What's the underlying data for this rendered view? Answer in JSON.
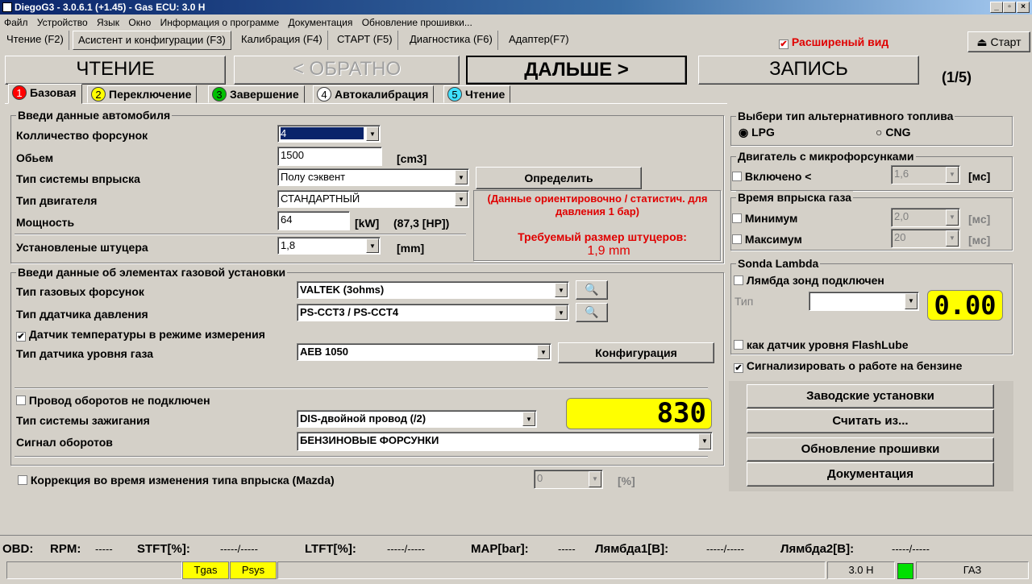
{
  "window": {
    "title": "DiegoG3 - 3.0.6.1 (+1.45) - Gas ECU: 3.0 H",
    "min": "_",
    "max": "▫",
    "close": "×"
  },
  "menu": [
    "Файл",
    "Устройство",
    "Язык",
    "Окно",
    "Информация о программе",
    "Документация",
    "Обновление прошивки..."
  ],
  "toptabs": [
    "Чтение (F2)",
    "Асистент и конфигурации (F3)",
    "Калибрация (F4)",
    "СТАРТ (F5)",
    "Диагностика (F6)",
    "Адаптер(F7)"
  ],
  "extended_view": {
    "label": "Расширеный вид",
    "checked": "✔"
  },
  "start_button": "Старт",
  "nav": {
    "read": "ЧТЕНИЕ",
    "back": "< ОБРАТНО",
    "next": "ДАЛЬШЕ >",
    "write": "ЗАПИСЬ",
    "step": "(1/5)"
  },
  "subtabs": [
    {
      "num": "1",
      "label": "Базовая",
      "color": "#ff0000"
    },
    {
      "num": "2",
      "label": "Переключение",
      "color": "#ffff00"
    },
    {
      "num": "3",
      "label": "Завершение",
      "color": "#00c000"
    },
    {
      "num": "4",
      "label": "Автокалибрация",
      "color": "#ffffff"
    },
    {
      "num": "5",
      "label": "Чтение",
      "color": "#40e0ff"
    }
  ],
  "car": {
    "title": "Введи данные автомобиля",
    "injectors_label": "Колличество форсунок",
    "injectors_value": "4",
    "volume_label": "Обьем",
    "volume_value": "1500",
    "volume_unit": "[cm3]",
    "injection_label": "Тип системы впрыска",
    "injection_value": "Полу сэквент",
    "engine_label": "Тип двигателя",
    "engine_value": "СТАНДАРТНЫЙ",
    "power_label": "Мощность",
    "power_value": "64",
    "power_unit": "[kW]",
    "power_hp": "(87,3 [HP])",
    "nozzle_label": "Установленые штуцера",
    "nozzle_value": "1,8",
    "nozzle_unit": "[mm]",
    "determine_button": "Определить",
    "note": "(Данные ориентировочно / статистич. для давления 1 бар)",
    "required_label": "Требуемый размер штуцеров:",
    "required_value": "1,9 mm"
  },
  "gas": {
    "title": "Введи данные об элементах газовой установки",
    "injector_type_label": "Тип газовых форсунок",
    "injector_type_value": "VALTEK (3ohms)",
    "pressure_label": "Тип ддатчика давления",
    "pressure_value": "PS-CCT3 / PS-CCT4",
    "temp_label": "Датчик температуры в режиме измерения",
    "temp_checked": "✔",
    "level_label": "Тип датчика уровня газа",
    "level_value": "AEB 1050",
    "config_button": "Конфигурация",
    "rpm_wire_label": "Провод оборотов не подключен",
    "ignition_label": "Тип системы зажигания",
    "ignition_value": "DIS-двойной провод (/2)",
    "rpm_signal_label": "Сигнал оборотов",
    "rpm_signal_value": "БЕНЗИНОВЫЕ ФОРСУНКИ",
    "rpm_display": "830"
  },
  "correction": {
    "label": "Коррекция во время изменения типа впрыска (Mazda)",
    "value": "0",
    "unit": "[%]"
  },
  "fuel": {
    "title": "Выбери тип альтернативного топлива",
    "lpg": "LPG",
    "cng": "CNG"
  },
  "micro": {
    "title": "Двигатель с микрофорсунками",
    "enabled_label": "Включено <",
    "value": "1,6",
    "unit": "[мс]"
  },
  "gas_time": {
    "title": "Время впрыска газа",
    "min_label": "Минимум",
    "min_value": "2,0",
    "min_unit": "[мс]",
    "max_label": "Максимум",
    "max_value": "20",
    "max_unit": "[мс]"
  },
  "lambda": {
    "title": "Sonda Lambda",
    "connected_label": "Лямбда зонд подключен",
    "type_label": "Тип",
    "display": "0.00",
    "flashlube_label": "как датчик уровня FlashLube"
  },
  "petrol_signal": {
    "label": "Сигнализировать о работе на бензине",
    "checked": "✔"
  },
  "side_buttons": [
    "Заводские установки",
    "Считать из...",
    "Обновление прошивки",
    "Документация"
  ],
  "obd": {
    "obd": "OBD:",
    "rpm": "RPM:",
    "rpm_val": "-----",
    "stft": "STFT[%]:",
    "stft_val": "-----/-----",
    "ltft": "LTFT[%]:",
    "ltft_val": "-----/-----",
    "map": "MAP[bar]:",
    "map_val": "-----",
    "l1": "Лямбда1[В]:",
    "l1_val": "-----/-----",
    "l2": "Лямбда2[В]:",
    "l2_val": "-----/-----"
  },
  "status": {
    "tgas": "Tgas",
    "psys": "Psys",
    "version": "3.0 H",
    "mode": "ГАЗ"
  }
}
